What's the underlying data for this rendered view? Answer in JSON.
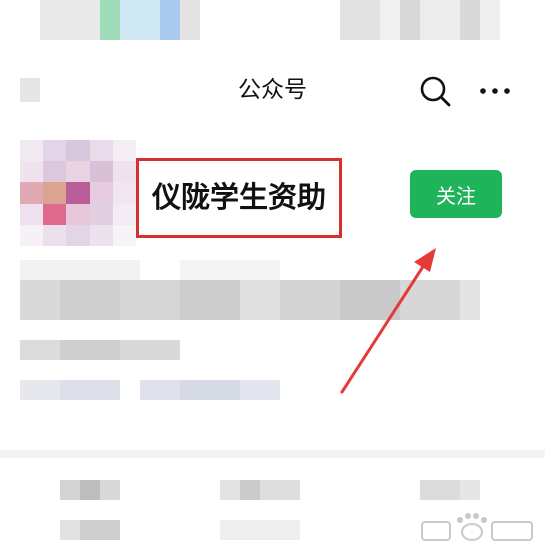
{
  "nav": {
    "title": "公众号",
    "search_icon": "search-icon",
    "more_icon": "more-icon"
  },
  "account": {
    "name": "仪陇学生资助",
    "follow_label": "关注"
  },
  "colors": {
    "follow_green": "#1fb35a",
    "highlight_red": "#d6322d",
    "arrow_red": "#e53a35"
  }
}
